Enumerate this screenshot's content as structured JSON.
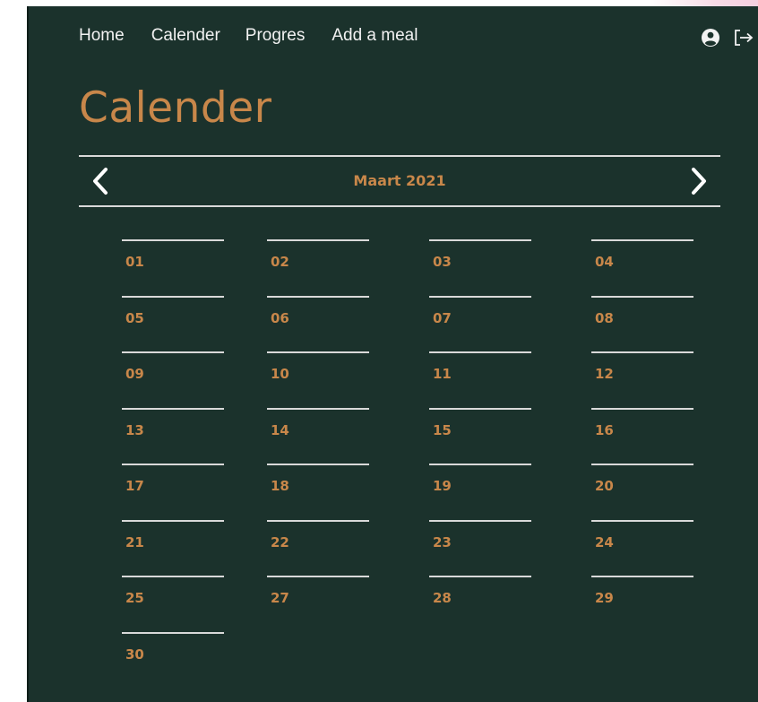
{
  "nav": {
    "links": [
      "Home",
      "Calender",
      "Progres",
      "Add a meal"
    ],
    "account_icon": "user-circle-icon",
    "logout_icon": "logout-icon"
  },
  "page": {
    "title": "Calender"
  },
  "calendar": {
    "month_label": "Maart 2021",
    "prev_icon": "chevron-left-icon",
    "next_icon": "chevron-right-icon",
    "days": [
      "01",
      "02",
      "03",
      "04",
      "05",
      "06",
      "07",
      "08",
      "09",
      "10",
      "11",
      "12",
      "13",
      "14",
      "15",
      "16",
      "17",
      "18",
      "19",
      "20",
      "21",
      "22",
      "23",
      "24",
      "25",
      "27",
      "28",
      "29",
      "30"
    ]
  },
  "colors": {
    "background": "#1b322c",
    "accent": "#c8874a",
    "text": "#f2f2f2",
    "line": "#d9d9d9"
  }
}
